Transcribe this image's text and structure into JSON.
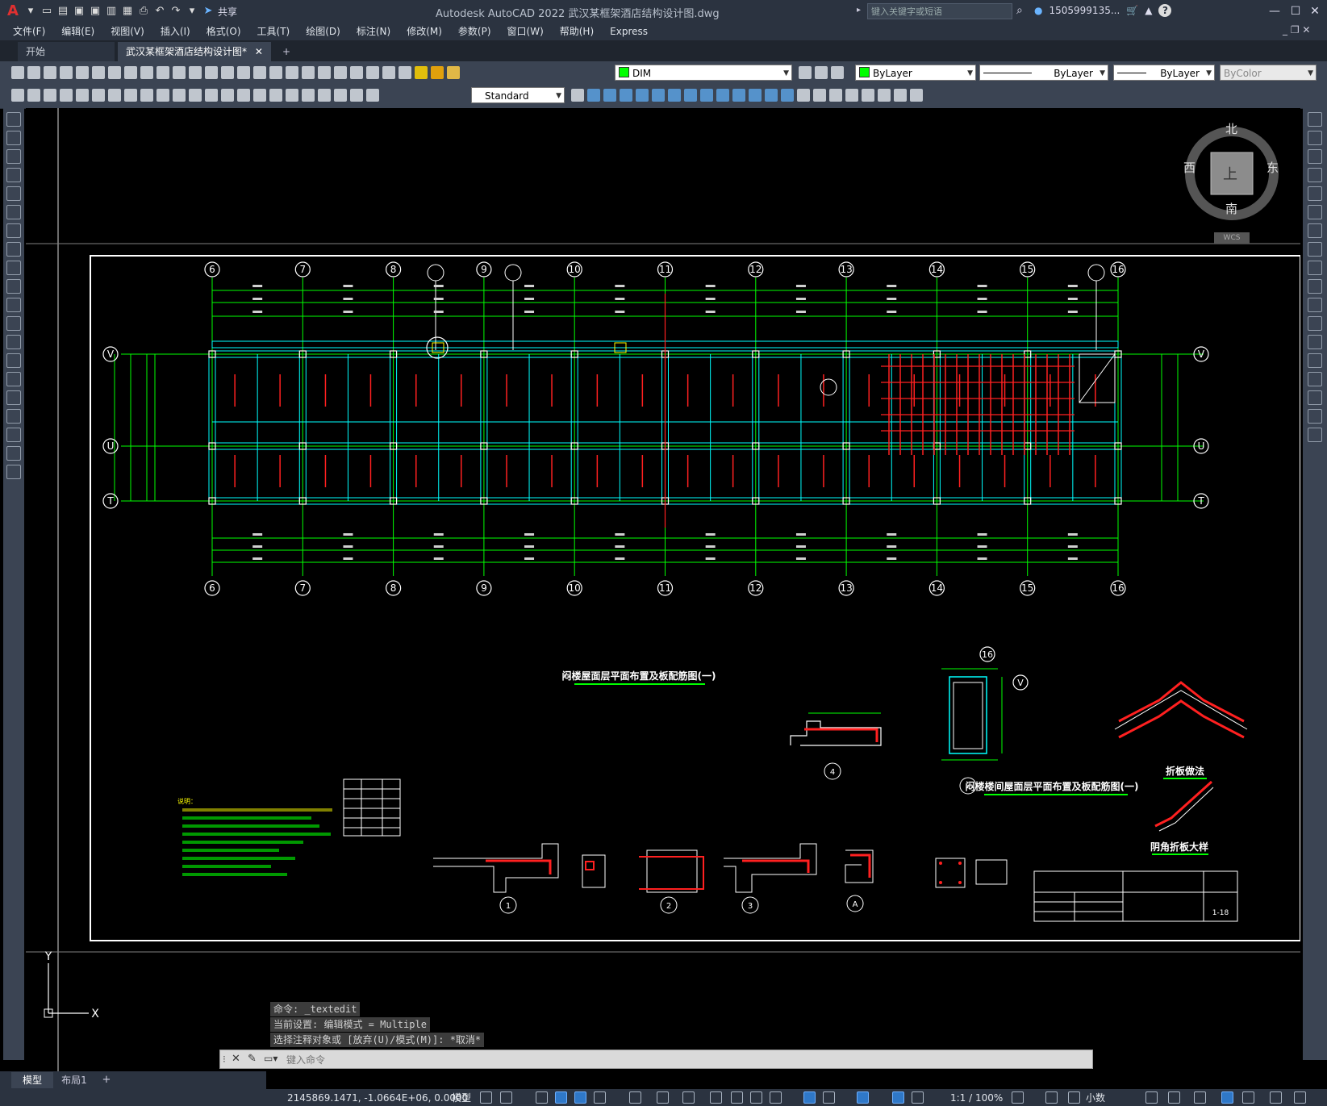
{
  "app": {
    "title": "Autodesk AutoCAD 2022    武汉某框架酒店结构设计图.dwg",
    "share_label": "共享",
    "search_placeholder": "键入关键字或短语",
    "user": "1505999135...",
    "colors": {
      "accent": "#2f78c8",
      "canvas": "#000000",
      "chrome": "#2b3340"
    }
  },
  "menu": [
    "文件(F)",
    "编辑(E)",
    "视图(V)",
    "插入(I)",
    "格式(O)",
    "工具(T)",
    "绘图(D)",
    "标注(N)",
    "修改(M)",
    "参数(P)",
    "窗口(W)",
    "帮助(H)",
    "Express"
  ],
  "tabs": {
    "start": "开始",
    "active": "武汉某框架酒店结构设计图*",
    "add": "+"
  },
  "toolbar": {
    "layer": "DIM",
    "color": "ByLayer",
    "linetype": "ByLayer",
    "lineweight": "ByLayer",
    "plotstyle": "ByColor",
    "textstyle": "Standard"
  },
  "viewcube": {
    "north": "北",
    "south": "南",
    "east": "东",
    "west": "西",
    "top": "上",
    "wcs": "WCS"
  },
  "drawing": {
    "top_axes": [
      "6",
      "7",
      "8",
      "9",
      "10",
      "11",
      "12",
      "13",
      "14",
      "15",
      "16"
    ],
    "row_axes": [
      "V",
      "U",
      "T"
    ],
    "plan_title": "闷楼屋面层平面布置及板配筋图(一)",
    "stair_title": "闷楼楼间屋面层平面布置及板配筋图(一)",
    "detail_fold": "折板做法",
    "detail_corner": "阴角折板大样",
    "notes_heading": "说明：",
    "detail_numbers": [
      "1",
      "2",
      "3",
      "4",
      "A"
    ],
    "sheet_no": "1-18",
    "axis_16": "16",
    "axis_v": "V"
  },
  "command": {
    "history": [
      "命令: _textedit",
      "当前设置: 编辑模式 = Multiple",
      "选择注释对象或 [放弃(U)/模式(M)]: *取消*"
    ],
    "placeholder": "键入命令"
  },
  "layout_tabs": [
    "模型",
    "布局1",
    "+"
  ],
  "status": {
    "coords": "2145869.1471, -1.0664E+06, 0.0000",
    "model": "模型",
    "scale": "1:1 / 100%",
    "units": "小数"
  }
}
